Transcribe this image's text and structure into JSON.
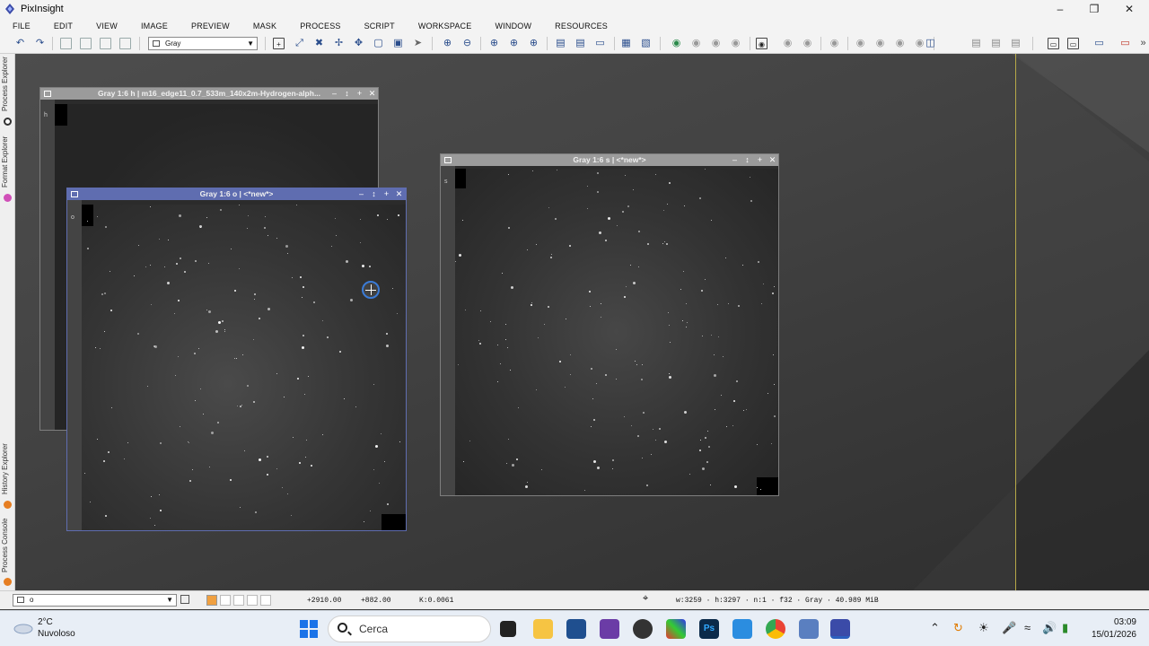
{
  "app": {
    "title": "PixInsight"
  },
  "menu": [
    "FILE",
    "EDIT",
    "VIEW",
    "IMAGE",
    "PREVIEW",
    "MASK",
    "PROCESS",
    "SCRIPT",
    "WORKSPACE",
    "WINDOW",
    "RESOURCES"
  ],
  "toolbar": {
    "color_space": "Gray"
  },
  "left_tabs": [
    "Process Explorer",
    "Format Explorer",
    "History Explorer",
    "Process Console"
  ],
  "windows": {
    "h": {
      "title": "Gray 1:6 h | m16_edge11_0.7_533m_140x2m-Hydrogen-alph...",
      "channel": "h"
    },
    "o": {
      "title": "Gray 1:6 o | <*new*>",
      "channel": "o"
    },
    "s": {
      "title": "Gray 1:6 s | <*new*>",
      "channel": "s"
    }
  },
  "statusbar": {
    "view": "o",
    "x": "+2910.00",
    "y": "+882.00",
    "k": "K:0.0061",
    "info": "w:3259 · h:3297 · n:1 · f32 · Gray · 40.989 MiB"
  },
  "taskbar": {
    "temp": "2°C",
    "weather": "Nuvoloso",
    "search_placeholder": "Cerca",
    "time": "03:09",
    "date": "15/01/2026"
  },
  "colors": {
    "active_window": "#5f6db0",
    "inactive_window": "#9b9b9b",
    "accent_line": "#b7a948"
  }
}
